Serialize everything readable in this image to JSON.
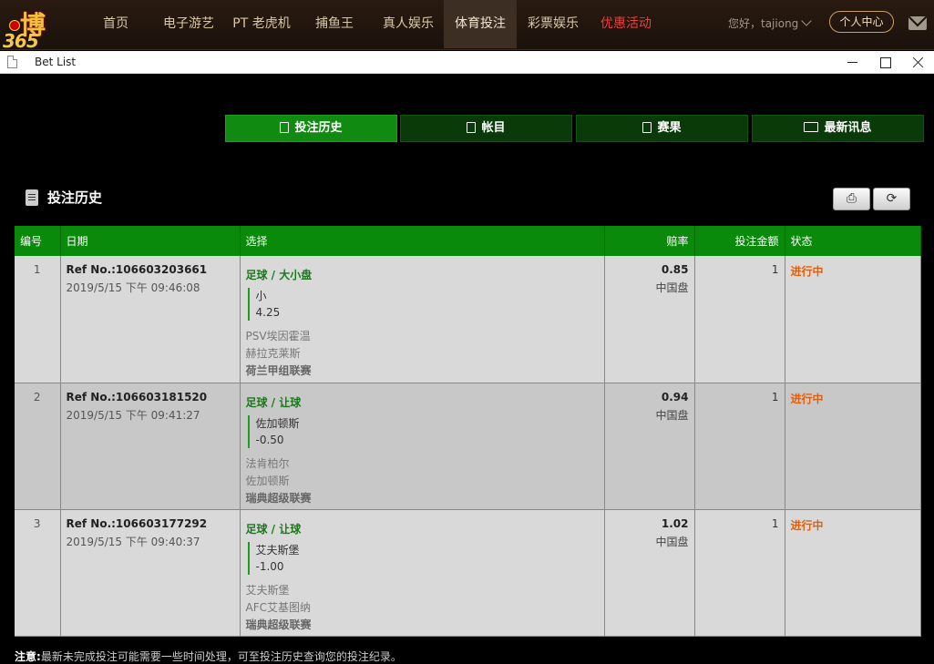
{
  "site": {
    "logo_text": "博",
    "logo_num": "365",
    "nav": [
      "首页",
      "电子游艺",
      "PT 老虎机",
      "捕鱼王",
      "真人娱乐",
      "体育投注",
      "彩票娱乐",
      "优惠活动"
    ],
    "greeting": "您好，tajiong",
    "user_center": "个人中心"
  },
  "window": {
    "title": "Bet List"
  },
  "tabs": [
    "投注历史",
    "帐目",
    "赛果",
    "最新讯息"
  ],
  "section_title": "投注历史",
  "table": {
    "headers": [
      "编号",
      "日期",
      "选择",
      "赔率",
      "投注金额",
      "状态"
    ],
    "rows": [
      {
        "no": "1",
        "ref": "Ref No.:106603203661",
        "date": "2019/5/15 下午 09:46:08",
        "sport": "足球 / 大小盘",
        "pick": "小",
        "line": "4.25",
        "home": "PSV埃因霍温",
        "away": "赫拉克莱斯",
        "league": "荷兰甲组联赛",
        "odds": "0.85",
        "market": "中国盘",
        "stake": "1",
        "status": "进行中"
      },
      {
        "no": "2",
        "ref": "Ref No.:106603181520",
        "date": "2019/5/15 下午 09:41:27",
        "sport": "足球 / 让球",
        "pick": "佐加顿斯",
        "line": "-0.50",
        "home": "法肯柏尔",
        "away": "佐加顿斯",
        "league": "瑞典超级联赛",
        "odds": "0.94",
        "market": "中国盘",
        "stake": "1",
        "status": "进行中"
      },
      {
        "no": "3",
        "ref": "Ref No.:106603177292",
        "date": "2019/5/15 下午 09:40:37",
        "sport": "足球 / 让球",
        "pick": "艾夫斯堡",
        "line": "-1.00",
        "home": "艾夫斯堡",
        "away": "AFC艾基图纳",
        "league": "瑞典超级联赛",
        "odds": "1.02",
        "market": "中国盘",
        "stake": "1",
        "status": "进行中"
      }
    ]
  },
  "note": {
    "label": "注意:",
    "text": "最新未完成投注可能需要一些时间处理，可至投注历史查询您的投注纪录。"
  }
}
